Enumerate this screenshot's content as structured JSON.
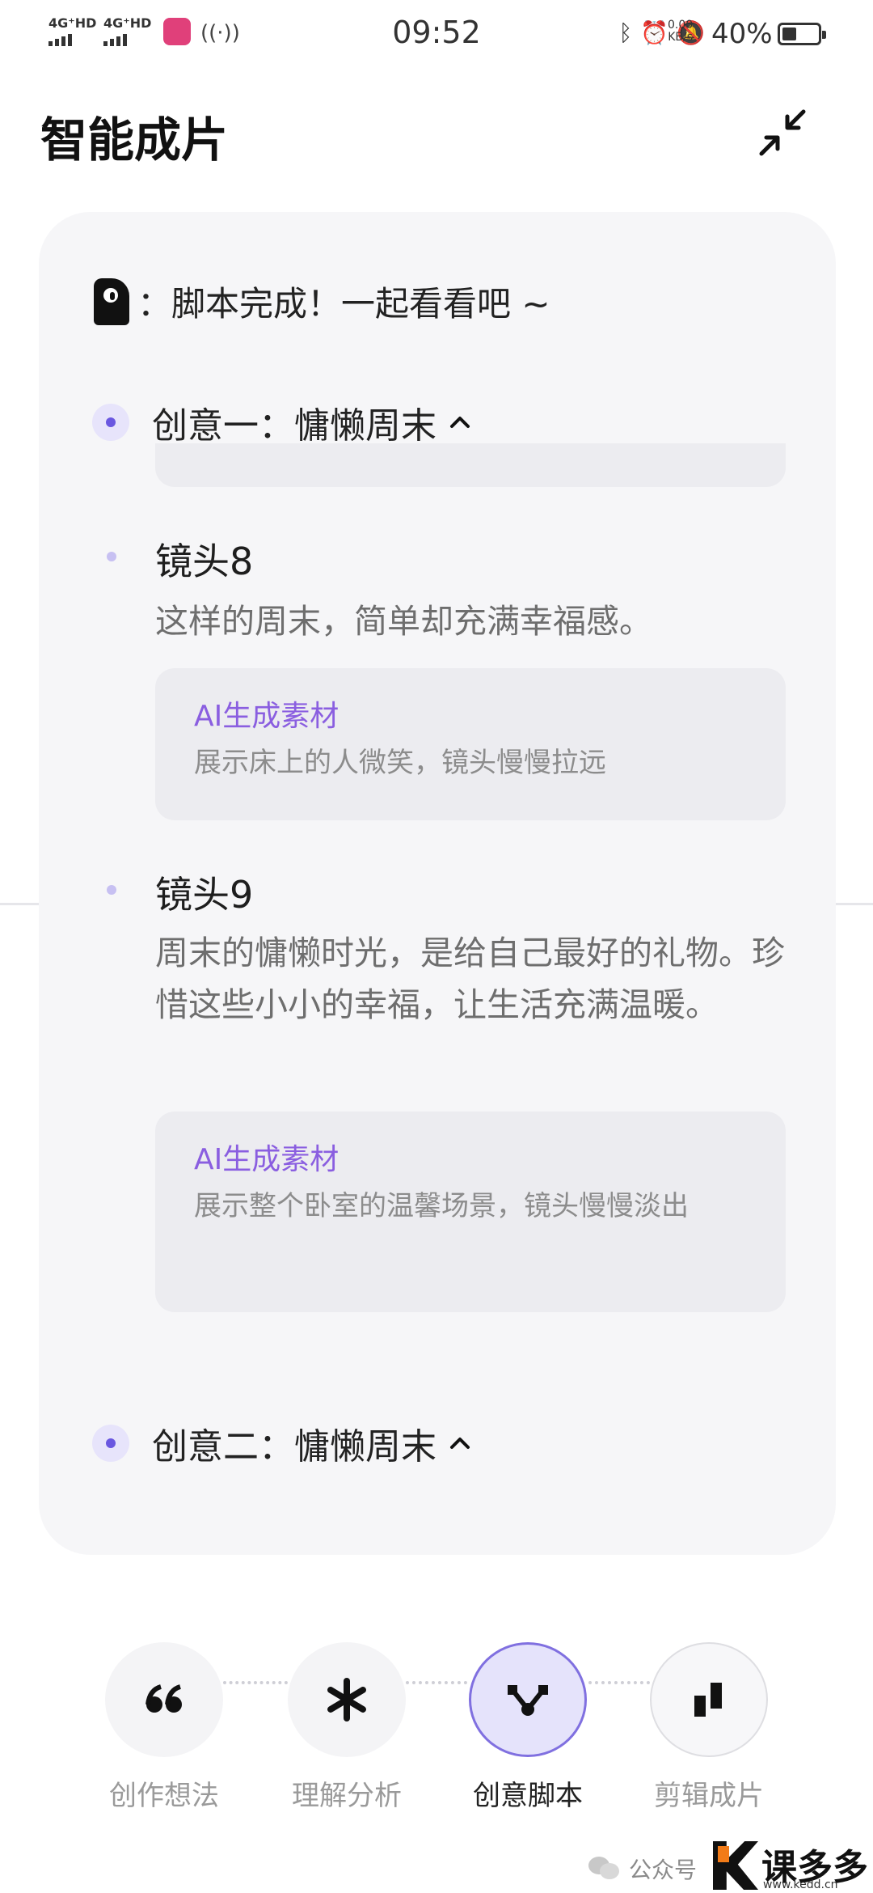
{
  "status_bar": {
    "sim1": "4G⁺HD",
    "sim2": "4G⁺HD",
    "time": "09:52",
    "speed_value": "0.00",
    "speed_unit": "KB/s",
    "battery_pct": "40%",
    "battery_level": 0.4
  },
  "header": {
    "title": "智能成片",
    "collapse_icon": "collapse-arrows-icon"
  },
  "script_panel": {
    "completion_prefix": "：",
    "completion_text": "脚本完成！一起看看吧 ~",
    "ideas": [
      {
        "label": "创意一：慵懒周末"
      },
      {
        "label": "创意二：慵懒周末"
      }
    ],
    "shots": [
      {
        "title": "镜头8",
        "text": "这样的周末，简单却充满幸福感。",
        "ai_label": "AI生成素材",
        "ai_desc": "展示床上的人微笑，镜头慢慢拉远"
      },
      {
        "title": "镜头9",
        "text": "周末的慵懒时光，是给自己最好的礼物。珍惜这些小小的幸福，让生活充满温暖。",
        "ai_label": "AI生成素材",
        "ai_desc": "展示整个卧室的温馨场景，镜头慢慢淡出"
      }
    ]
  },
  "stepper": {
    "steps": [
      {
        "label": "创作想法",
        "icon": "quote-icon"
      },
      {
        "label": "理解分析",
        "icon": "asterisk-icon"
      },
      {
        "label": "创意脚本",
        "icon": "nodes-icon",
        "active": true
      },
      {
        "label": "剪辑成片",
        "icon": "bars-icon"
      }
    ]
  },
  "footer": {
    "watermark": "公众号",
    "brand": "课多多",
    "brand_url": "www.kedd.cn"
  },
  "colors": {
    "accent": "#6a57e0",
    "ai_label": "#8a5ee0",
    "panel_bg": "#f6f6f8"
  }
}
